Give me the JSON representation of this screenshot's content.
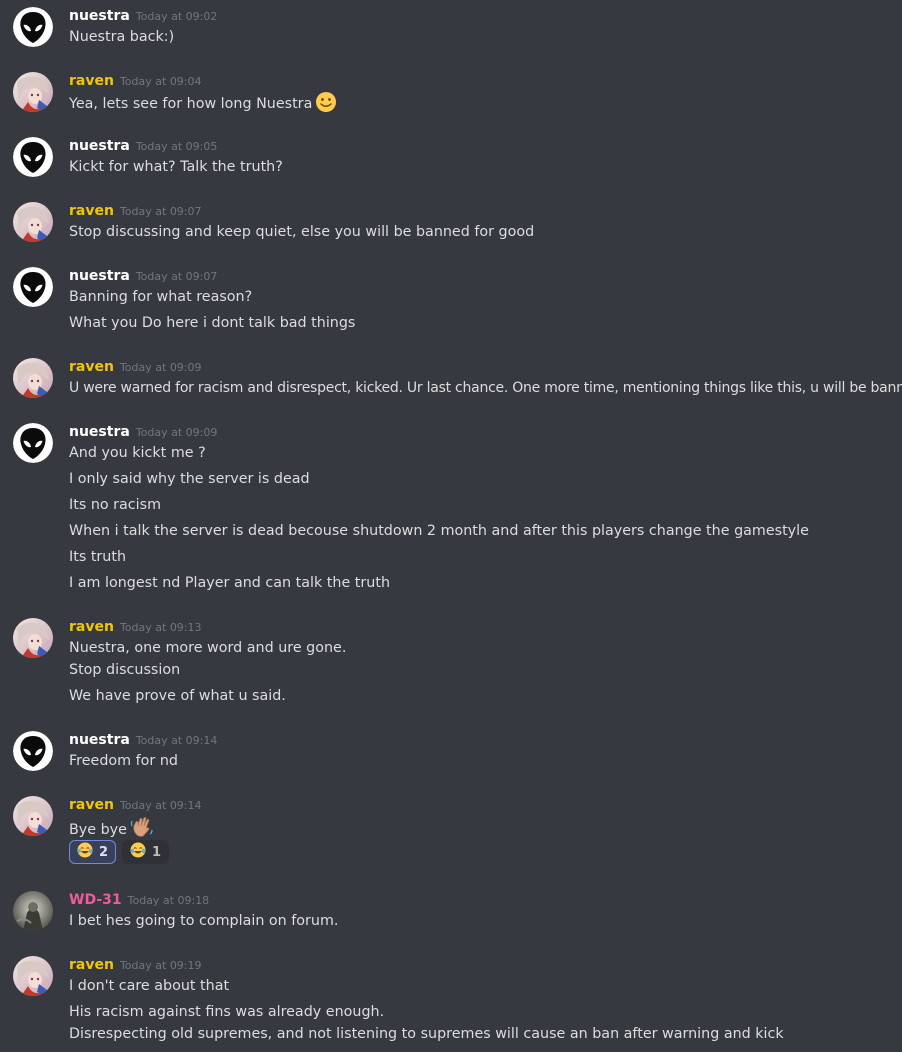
{
  "users": {
    "nuestra": {
      "name": "nuestra",
      "color": "#ffffff",
      "avatar": "alien-avatar"
    },
    "raven": {
      "name": "raven",
      "color": "#f1c40f",
      "avatar": "anime-avatar"
    },
    "wd31": {
      "name": "WD-31",
      "color": "#ef5b9c",
      "avatar": "photo-avatar"
    }
  },
  "messages": [
    {
      "user": "nuestra",
      "time": "Today at 09:02",
      "lines": [
        "Nuestra back:)"
      ]
    },
    {
      "user": "raven",
      "time": "Today at 09:04",
      "lines": [
        "Yea, lets see for how long Nuestra"
      ],
      "inline_emoji": "slightly-smiling-face"
    },
    {
      "user": "nuestra",
      "time": "Today at 09:05",
      "lines": [
        "Kickt for what? Talk  the truth?"
      ]
    },
    {
      "user": "raven",
      "time": "Today at 09:07",
      "lines": [
        "Stop discussing and keep quiet, else you will be banned for good"
      ]
    },
    {
      "user": "nuestra",
      "time": "Today at 09:07",
      "lines": [
        "Banning for what reason?",
        "What you Do here i dont talk bad things"
      ]
    },
    {
      "user": "raven",
      "time": "Today at 09:09",
      "lines": [
        "U were warned for racism and disrespect, kicked. Ur last chance. One more time, mentioning things like this, u will be banned"
      ]
    },
    {
      "user": "nuestra",
      "time": "Today at 09:09",
      "lines": [
        "And you kickt me ?",
        "I only said why the server is dead",
        "Its no racism",
        "When i talk the server is dead becouse shutdown 2 month and after this players change the gamestyle",
        "Its truth",
        "I am longest nd Player and can talk the truth"
      ]
    },
    {
      "user": "raven",
      "time": "Today at 09:13",
      "lines": [
        "Nuestra, one more word and ure gone.",
        "Stop discussion",
        "We have prove of what u said."
      ]
    },
    {
      "user": "nuestra",
      "time": "Today at 09:14",
      "lines": [
        "Freedom for nd"
      ]
    },
    {
      "user": "raven",
      "time": "Today at 09:14",
      "lines": [
        "Bye bye"
      ],
      "inline_emoji": "waving-hand",
      "reactions": [
        {
          "emoji": "tears-of-joy",
          "count": "2",
          "me": true
        },
        {
          "emoji": "tears-of-joy",
          "count": "1",
          "me": false
        }
      ]
    },
    {
      "user": "wd31",
      "time": "Today at 09:18",
      "lines": [
        "I bet hes going to complain on forum."
      ]
    },
    {
      "user": "raven",
      "time": "Today at 09:19",
      "lines": [
        "I don't care about that",
        "His racism against fins was already enough.",
        "Disrespecting old supremes, and not listening to supremes will cause an ban after warning and kick"
      ]
    }
  ]
}
